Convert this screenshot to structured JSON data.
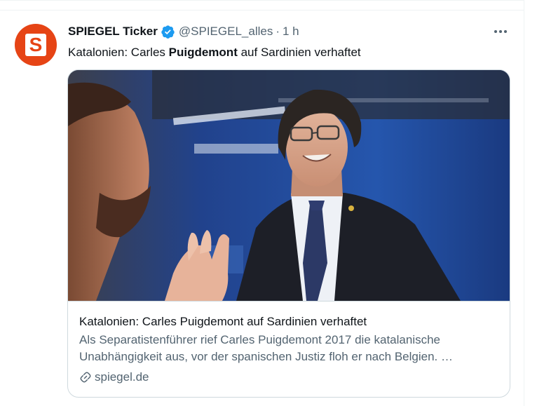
{
  "tweet": {
    "author_name": "SPIEGEL Ticker",
    "author_handle": "@SPIEGEL_alles",
    "separator": "·",
    "time": "1 h",
    "avatar_letter": "S",
    "text_before": "Katalonien: Carles ",
    "text_bold": "Puigdemont",
    "text_after": " auf Sardinien verhaftet"
  },
  "card": {
    "title": "Katalonien: Carles Puigdemont auf Sardinien verhaftet",
    "description_line1": "Als Separatistenführer rief Carles Puigdemont 2017 die katalanische",
    "description_line2": "Unabhängigkeit aus, vor der spanischen Justiz floh er nach Belgien. …",
    "domain": "spiegel.de"
  },
  "icons": {
    "verified": "verified-badge-icon",
    "more": "more-dots-icon",
    "link": "link-icon"
  },
  "colors": {
    "brand": "#e64415",
    "verified": "#1d9bf0",
    "secondary_text": "#536471"
  }
}
